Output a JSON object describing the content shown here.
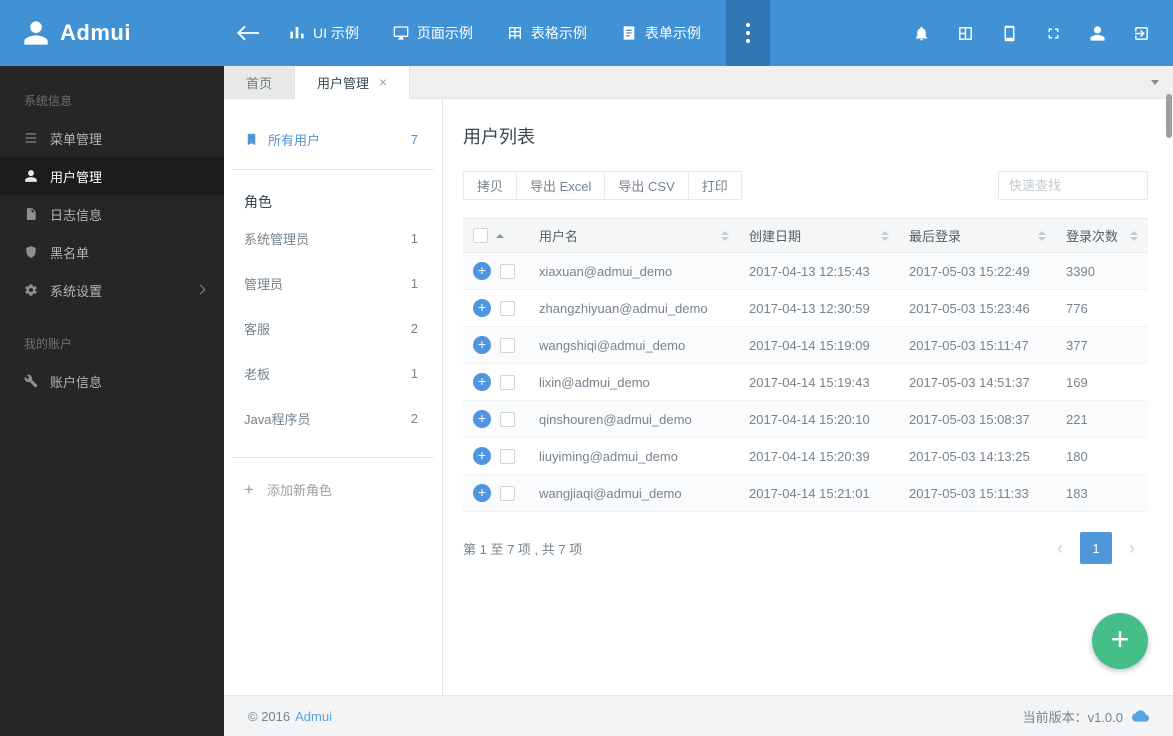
{
  "navbar": {
    "brand": "Admui",
    "menu": [
      {
        "label": "UI 示例"
      },
      {
        "label": "页面示例"
      },
      {
        "label": "表格示例"
      },
      {
        "label": "表单示例"
      }
    ]
  },
  "tabs": [
    {
      "label": "首页"
    },
    {
      "label": "用户管理"
    }
  ],
  "sidebar": {
    "sections": [
      {
        "label": "系统信息",
        "items": [
          {
            "label": "菜单管理"
          },
          {
            "label": "用户管理"
          },
          {
            "label": "日志信息"
          },
          {
            "label": "黑名单"
          },
          {
            "label": "系统设置"
          }
        ]
      },
      {
        "label": "我的账户",
        "items": [
          {
            "label": "账户信息"
          }
        ]
      }
    ]
  },
  "userpanel": {
    "all_users": {
      "label": "所有用户",
      "count": "7"
    },
    "roles_title": "角色",
    "roles": [
      {
        "name": "系统管理员",
        "count": "1"
      },
      {
        "name": "管理员",
        "count": "1"
      },
      {
        "name": "客服",
        "count": "2"
      },
      {
        "name": "老板",
        "count": "1"
      },
      {
        "name": "Java程序员",
        "count": "2"
      }
    ],
    "add_role_label": "添加新角色"
  },
  "main": {
    "title": "用户列表",
    "toolbar": {
      "buttons": [
        "拷贝",
        "导出 Excel",
        "导出 CSV",
        "打印"
      ],
      "search_placeholder": "快速查找"
    },
    "table": {
      "columns": [
        "用户名",
        "创建日期",
        "最后登录",
        "登录次数"
      ],
      "rows": [
        {
          "username": "xiaxuan@admui_demo",
          "created": "2017-04-13 12:15:43",
          "last_login": "2017-05-03 15:22:49",
          "logins": "3390"
        },
        {
          "username": "zhangzhiyuan@admui_demo",
          "created": "2017-04-13 12:30:59",
          "last_login": "2017-05-03 15:23:46",
          "logins": "776"
        },
        {
          "username": "wangshiqi@admui_demo",
          "created": "2017-04-14 15:19:09",
          "last_login": "2017-05-03 15:11:47",
          "logins": "377"
        },
        {
          "username": "lixin@admui_demo",
          "created": "2017-04-14 15:19:43",
          "last_login": "2017-05-03 14:51:37",
          "logins": "169"
        },
        {
          "username": "qinshouren@admui_demo",
          "created": "2017-04-14 15:20:10",
          "last_login": "2017-05-03 15:08:37",
          "logins": "221"
        },
        {
          "username": "liuyiming@admui_demo",
          "created": "2017-04-14 15:20:39",
          "last_login": "2017-05-03 14:13:25",
          "logins": "180"
        },
        {
          "username": "wangjiaqi@admui_demo",
          "created": "2017-04-14 15:21:01",
          "last_login": "2017-05-03 15:11:33",
          "logins": "183"
        }
      ]
    },
    "pagination": {
      "info": "第 1 至 7 项 , 共 7 项",
      "page": "1"
    }
  },
  "footer": {
    "copyright": "© 2016",
    "brand": "Admui",
    "version": "当前版本：v1.0.0"
  },
  "colors": {
    "primary": "#4191d5",
    "accent": "#4e97d9",
    "fab_green": "#46be8a",
    "sidebar_bg": "#262626"
  }
}
